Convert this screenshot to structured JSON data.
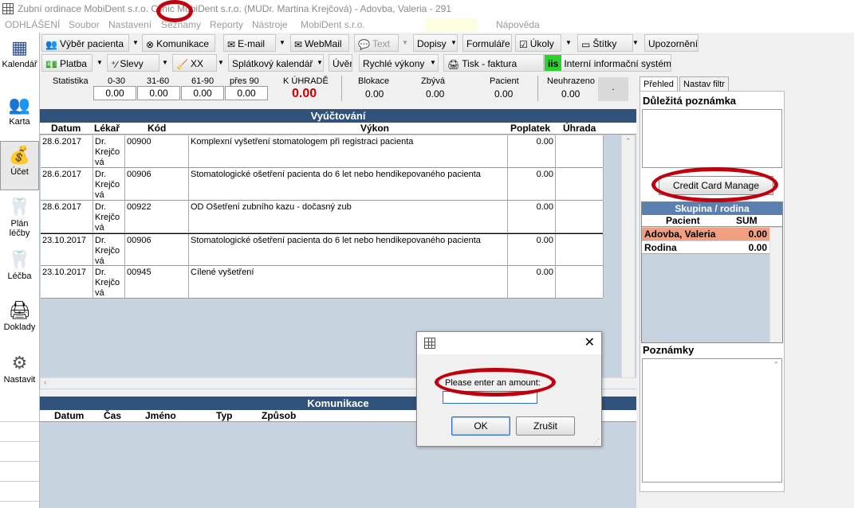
{
  "titlebar": {
    "title": "Zubní ordinace MobiDent s.r.o. Clinic MobiDent s.r.o. (MUDr. Martina Krejčová) - Adovba, Valeria - 291"
  },
  "menu": {
    "items": [
      "ODHLÁŠENÍ",
      "Soubor",
      "Nastavení",
      "Seznamy",
      "Reporty",
      "Nástroje",
      "MobiDent s.r.o.",
      "Nápověda"
    ]
  },
  "toolbar1": {
    "vyber": "Výběr pacienta",
    "komunikace": "Komunikace",
    "email": "E-mail",
    "webmail": "WebMail",
    "text": "Text",
    "dopisy": "Dopisy",
    "formulare": "Formuláře",
    "ukoly": "Úkoly",
    "stitky": "Štítky",
    "upozorneni": "Upozornění"
  },
  "toolbar2": {
    "platba": "Platba",
    "slevy": "Slevy",
    "xx": "XX",
    "splatkovy": "Splátkový kalendář",
    "uver": "Úvěr",
    "rychle": "Rychlé výkony",
    "tisk": "Tisk - faktura",
    "iis_badge": "iis",
    "iis": "Interní informační systém"
  },
  "sidebar": {
    "items": [
      "Kalendář",
      "Karta",
      "Účet",
      "Plán léčby",
      "Léčba",
      "Doklady",
      "Nastavit"
    ]
  },
  "stats": {
    "label": "Statistika",
    "h1": "0-30",
    "h2": "31-60",
    "h3": "61-90",
    "h4": "přes 90",
    "v1": "0.00",
    "v2": "0.00",
    "v3": "0.00",
    "v4": "0.00",
    "kuhrade_label": "K ÚHRADĚ",
    "kuhrade_value": "0.00",
    "blokace_label": "Blokace",
    "blokace_value": "0.00",
    "zbyva_label": "Zbývá",
    "zbyva_value": "0.00",
    "pacient_label": "Pacient",
    "pacient_value": "0.00",
    "neuhrazeno_label": "Neuhrazeno",
    "neuhrazeno_value": "0.00",
    "dot": "."
  },
  "billing": {
    "title": "Vyúčtování",
    "columns": [
      "Datum",
      "Lékař",
      "Kód",
      "Výkon",
      "Poplatek",
      "Úhrada"
    ],
    "rows": [
      {
        "datum": "28.6.2017",
        "lekar": "Dr. Krejčo vá",
        "kod": "00900",
        "vykon": "Komplexní vyšetření stomatologem při registraci pacienta",
        "poplatek": "0.00"
      },
      {
        "datum": "28.6.2017",
        "lekar": "Dr. Krejčo vá",
        "kod": "00906",
        "vykon": "Stomatologické ošetření pacienta do 6 let nebo hendikepovaného pacienta",
        "poplatek": "0.00"
      },
      {
        "datum": "28.6.2017",
        "lekar": "Dr. Krejčo vá",
        "kod": "00922",
        "vykon": "OD Ošetření zubního kazu - dočasný zub",
        "poplatek": "0.00"
      },
      {
        "datum": "23.10.2017",
        "lekar": "Dr. Krejčo vá",
        "kod": "00906",
        "vykon": "Stomatologické ošetření pacienta do 6 let nebo hendikepovaného pacienta",
        "poplatek": "0.00"
      },
      {
        "datum": "23.10.2017",
        "lekar": "Dr. Krejčo vá",
        "kod": "00945",
        "vykon": "Cílené vyšetření",
        "poplatek": "0.00"
      }
    ]
  },
  "komunikace": {
    "title": "Komunikace",
    "columns": [
      "Datum",
      "Čas",
      "Jméno",
      "Typ",
      "Způsob"
    ]
  },
  "right": {
    "tab1": "Přehled",
    "tab2": "Nastav filtr",
    "poznamka": "Důležitá poznámka",
    "credit": "Credit Card Manage",
    "skupina": "Skupina / rodina",
    "col_pacient": "Pacient",
    "col_sum": "SUM",
    "row1_name": "Adovba, Valeria",
    "row1_sum": "0.00",
    "row2_name": "Rodina",
    "row2_sum": "0.00",
    "poznamky": "Poznámky"
  },
  "dialog": {
    "prompt": "Please enter an amount:",
    "value": "",
    "ok": "OK",
    "cancel": "Zrušit"
  },
  "colors": {
    "header_blue": "#31527b",
    "panel_blue": "#c7d3df",
    "highlight_row": "#f0a080",
    "annotation_red": "#c0000c",
    "total_red": "#cc0000"
  }
}
